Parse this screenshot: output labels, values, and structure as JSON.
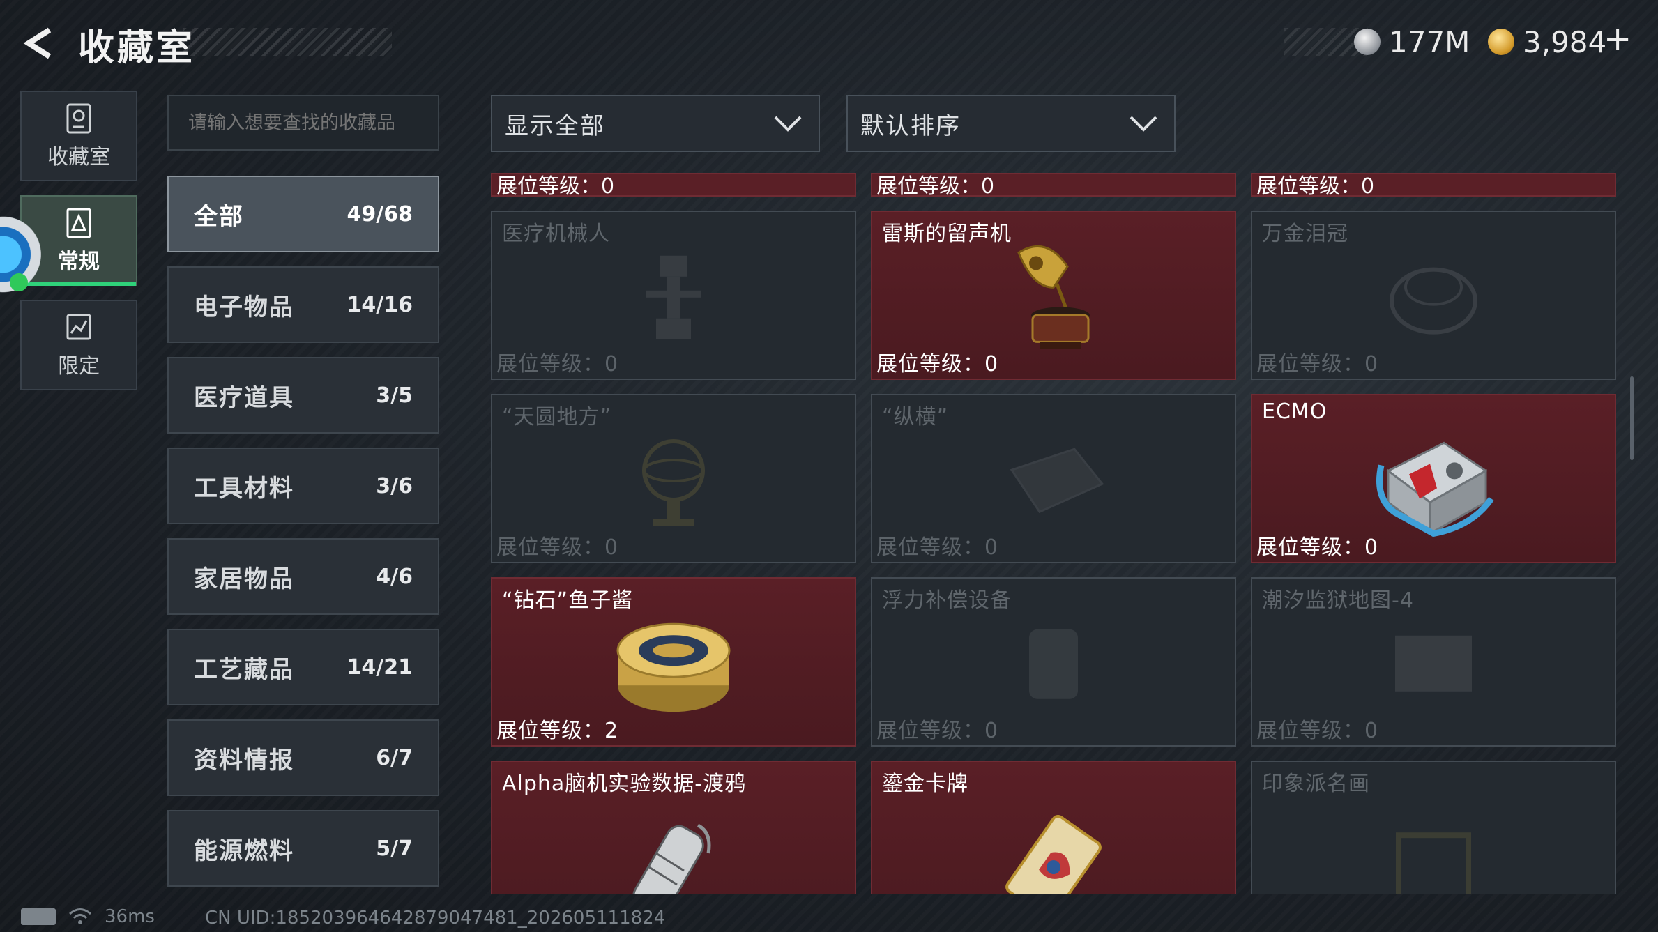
{
  "header": {
    "title": "收藏室"
  },
  "currency": [
    {
      "icon": "silver-coin-icon",
      "value": "177M"
    },
    {
      "icon": "gold-coin-icon",
      "value": "3,984"
    }
  ],
  "add_label": "+",
  "side_tabs": [
    {
      "label": "收藏室",
      "icon": "trophy-icon"
    },
    {
      "label": "常规",
      "icon": "document-icon"
    },
    {
      "label": "限定",
      "icon": "chart-icon"
    }
  ],
  "search": {
    "placeholder": "请输入想要查找的收藏品"
  },
  "categories": [
    {
      "name": "全部",
      "count": "49/68"
    },
    {
      "name": "电子物品",
      "count": "14/16"
    },
    {
      "name": "医疗道具",
      "count": "3/5"
    },
    {
      "name": "工具材料",
      "count": "3/6"
    },
    {
      "name": "家居物品",
      "count": "4/6"
    },
    {
      "name": "工艺藏品",
      "count": "14/21"
    },
    {
      "name": "资料情报",
      "count": "6/7"
    },
    {
      "name": "能源燃料",
      "count": "5/7"
    }
  ],
  "filters": {
    "show": "显示全部",
    "sort": "默认排序"
  },
  "level_label": "展位等级：",
  "top_row_levels": [
    "0",
    "0",
    "0"
  ],
  "items": [
    {
      "name": "医疗机械人",
      "level": "0",
      "owned": false
    },
    {
      "name": "雷斯的留声机",
      "level": "0",
      "owned": true
    },
    {
      "name": "万金泪冠",
      "level": "0",
      "owned": false
    },
    {
      "name": "“天圆地方”",
      "level": "0",
      "owned": false
    },
    {
      "name": "“纵横”",
      "level": "0",
      "owned": false
    },
    {
      "name": "ECMO",
      "level": "0",
      "owned": true
    },
    {
      "name": "“钻石”鱼子酱",
      "level": "2",
      "owned": true
    },
    {
      "name": "浮力补偿设备",
      "level": "0",
      "owned": false
    },
    {
      "name": "潮汐监狱地图-4",
      "level": "0",
      "owned": false
    },
    {
      "name": "Alpha脑机实验数据-渡鸦",
      "level": "",
      "owned": true
    },
    {
      "name": "鎏金卡牌",
      "level": "",
      "owned": true
    },
    {
      "name": "印象派名画",
      "level": "",
      "owned": false
    }
  ],
  "status": {
    "ping": "36ms",
    "uid": "CN UID:185203964642879047481_202605111824"
  },
  "colors": {
    "owned_card": "#5a1f26",
    "accent_green": "#2fd27a"
  }
}
